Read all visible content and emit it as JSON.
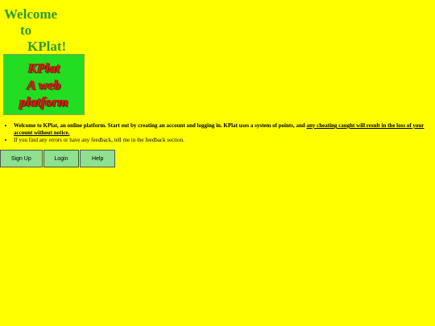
{
  "welcome": {
    "line1": "Welcome",
    "line2": "to",
    "line3": "KPlat!"
  },
  "logo": {
    "text": "KPlat\nA web\nplatform"
  },
  "info": {
    "item1_text": "Welcome to KPlat, an online platform. Start out by creating an account and logging in. KPlat uses a system of points, and ",
    "item1_warning": "any cheating caught will result in the loss of your account without notice.",
    "item2_text": "If you find any errors or have any feedback, tell me in the feedback section."
  },
  "buttons": {
    "signup_label": "Sign Up",
    "login_label": "Login",
    "help_label": "Help"
  },
  "colors": {
    "background": "#ffff00",
    "welcome_text": "#2e9a2e",
    "logo_bg": "#22dd22",
    "logo_text": "#dd1b1b",
    "button_bg": "#8fe08f"
  }
}
